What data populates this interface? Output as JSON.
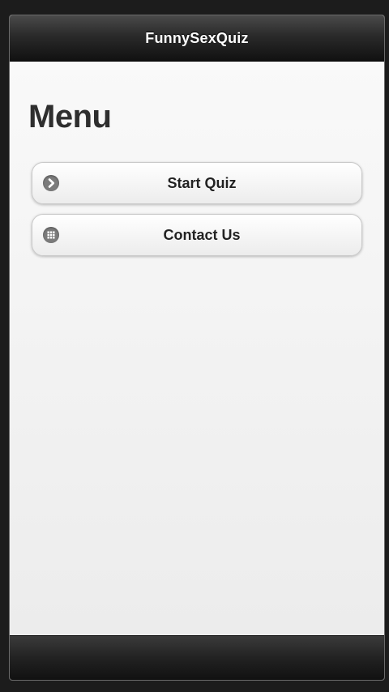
{
  "header": {
    "title": "FunnySexQuiz"
  },
  "page": {
    "heading": "Menu"
  },
  "menu": {
    "items": [
      {
        "label": "Start Quiz",
        "icon": "arrow-right-icon"
      },
      {
        "label": "Contact Us",
        "icon": "grid-icon"
      }
    ]
  },
  "colors": {
    "header_bg": "#222222",
    "content_bg": "#f4f4f4",
    "icon": "#7b7b7b",
    "heading_text": "#2e2e2e"
  }
}
